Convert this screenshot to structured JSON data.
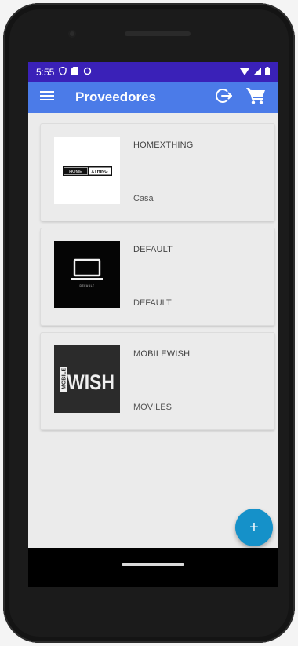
{
  "status_bar": {
    "time": "5:55",
    "icons_left": [
      "shield-icon",
      "sd-card-icon",
      "sync-icon"
    ],
    "icons_right": [
      "wifi-icon",
      "signal-icon",
      "battery-icon"
    ]
  },
  "app_bar": {
    "title": "Proveedores",
    "menu_icon": "menu-icon",
    "actions": [
      "logout-icon",
      "shopping-cart-icon"
    ]
  },
  "providers": [
    {
      "name": "HOMEXTHING",
      "category": "Casa",
      "logo_text_left": "HOME",
      "logo_text_right": "XTHING"
    },
    {
      "name": "DEFAULT",
      "category": "DEFAULT",
      "logo_text": "DEFAULT"
    },
    {
      "name": "MOBILEWISH",
      "category": "MOVILES",
      "logo_side_text": "MOBILE",
      "logo_main_text": "WISH"
    }
  ],
  "fab": {
    "label": "+"
  },
  "colors": {
    "status_bar": "#3a21b8",
    "app_bar": "#4b7be8",
    "fab": "#1591c9",
    "background": "#ebebeb"
  }
}
